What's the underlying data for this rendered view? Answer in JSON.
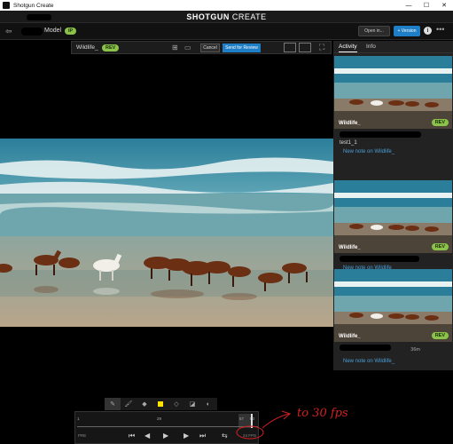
{
  "window": {
    "title": "Shotgun Create",
    "minimize": "—",
    "maximize": "☐",
    "close": "✕"
  },
  "app_header": {
    "brand_bold": "SHOTGUN",
    "brand_light": " CREATE"
  },
  "project_bar": {
    "back_icon": "arrow-left-icon",
    "breadcrumb_suffix": "Model",
    "status": "IP",
    "open_in_label": "Open in...",
    "version_label": "+ Version",
    "info_label": "i",
    "more_label": "•••"
  },
  "viewer_toolbar": {
    "media_name": "Wildlife_",
    "status": "REV",
    "cancel_label": "Cancel",
    "send_label": "Send for Review"
  },
  "panel": {
    "tabs": [
      {
        "label": "Activity"
      },
      {
        "label": "Info"
      }
    ],
    "cards": [
      {
        "name": "Wildlife_",
        "status": "REV",
        "user": "test1_1",
        "note": "New note on Wildlife_",
        "time": ""
      },
      {
        "name": "Wildlife_",
        "status": "REV",
        "user": "",
        "note": "New note on Wildlife_",
        "time": ""
      },
      {
        "name": "Wildlife_",
        "status": "REV",
        "user": "",
        "note": "New note on Wildlife_",
        "time": "36m"
      }
    ]
  },
  "timeline": {
    "ticks": [
      "1",
      "29",
      "57",
      "63"
    ],
    "left_label": "PRE",
    "fps_label": "24 FPS"
  },
  "annotation_text": "to 30 fps",
  "colors": {
    "accent_blue": "#1e7fc6",
    "status_green": "#8bc34a",
    "annotation_red": "#d32020"
  }
}
